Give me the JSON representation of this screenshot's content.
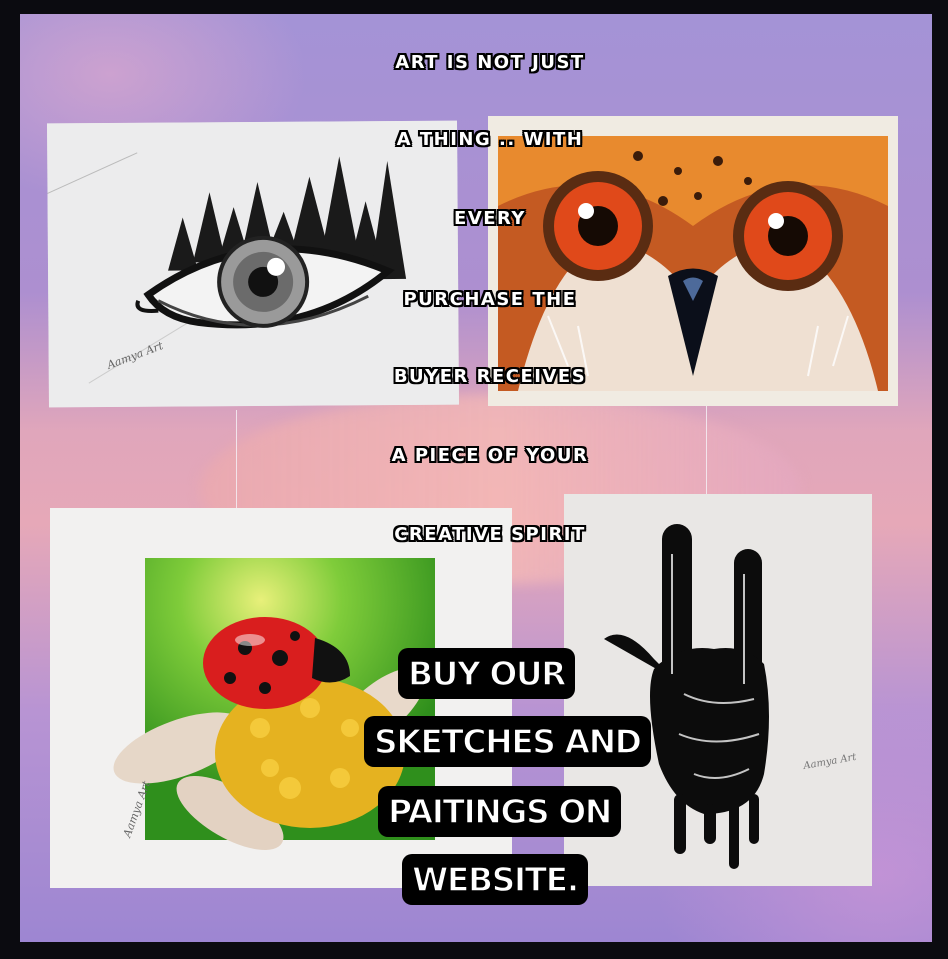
{
  "headline": {
    "lines": [
      "ART IS NOT JUST",
      "A THING .. WITH",
      "EVERY",
      "PURCHASE THE",
      "BUYER RECEIVES",
      "A PIECE OF YOUR",
      "CREATIVE SPIRIT"
    ]
  },
  "cta": {
    "lines": [
      "BUY OUR",
      "SKETCHES AND",
      "PAITINGS ON",
      "WEBSITE."
    ]
  },
  "artworks": [
    {
      "subject": "eye-sketch",
      "signature": "Aamya Art"
    },
    {
      "subject": "owl-eyes-painting"
    },
    {
      "subject": "ladybug-on-flower-painting",
      "signature": "Aamya Art"
    },
    {
      "subject": "rock-hand-sketch",
      "signature": "Aamya Art"
    }
  ],
  "colors": {
    "background_purple": "#a493d6",
    "background_pink": "#e6a8b8",
    "text_fill": "#ffffff",
    "text_outline": "#000000"
  }
}
